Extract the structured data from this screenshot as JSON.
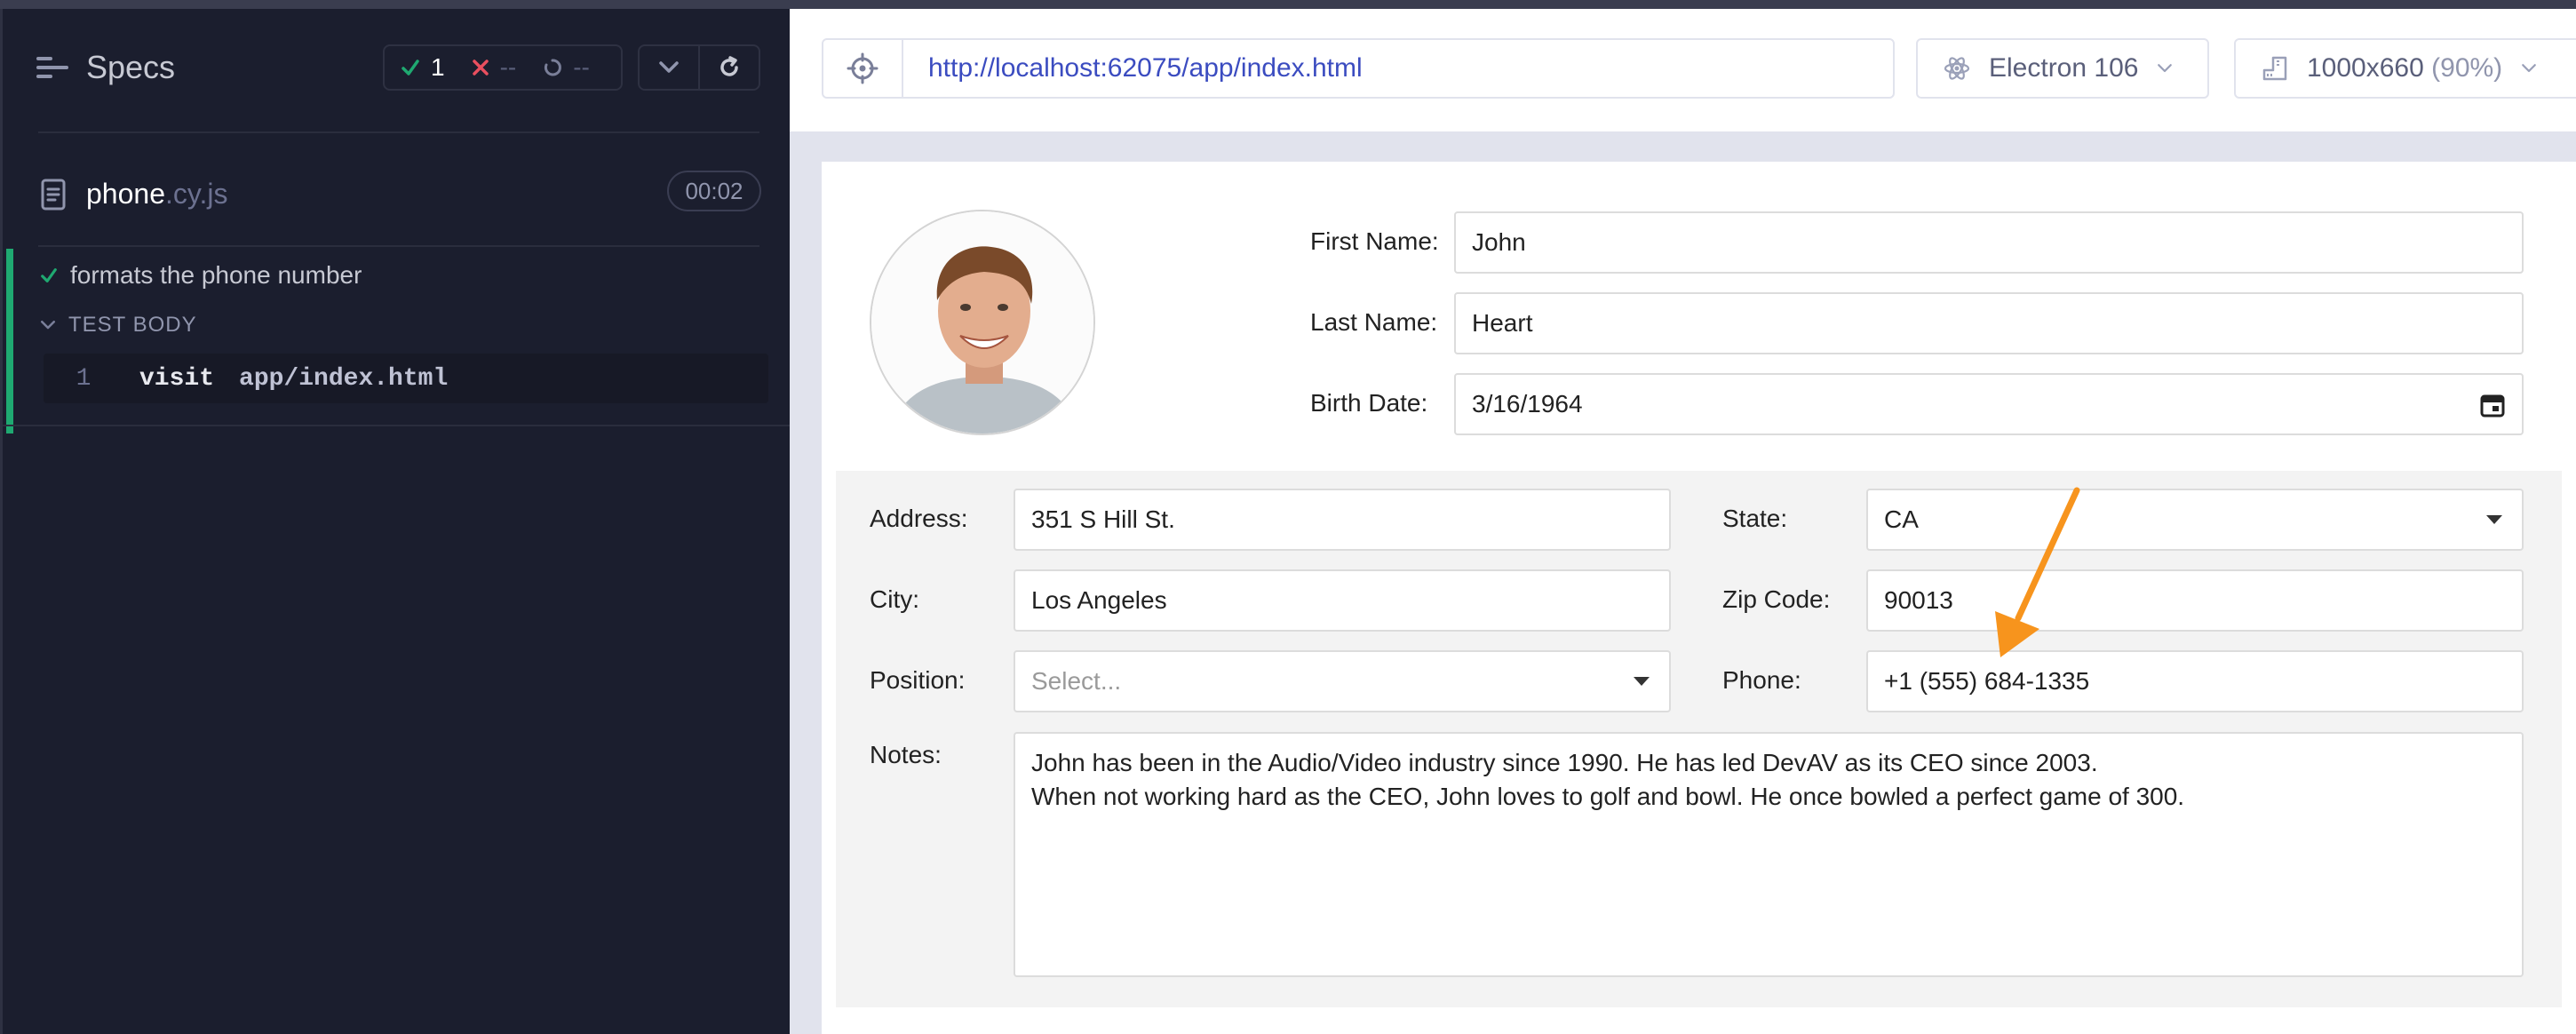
{
  "reporter": {
    "specs_label": "Specs",
    "stats": {
      "passed": "1",
      "failed": "--",
      "pending": "--"
    },
    "spec": {
      "name": "phone",
      "ext": ".cy.js",
      "duration": "00:02"
    },
    "test": {
      "title": "formats the phone number",
      "section": "TEST BODY",
      "command": {
        "number": "1",
        "name": "visit",
        "arg": "app/index.html"
      }
    }
  },
  "aut": {
    "url": "http://localhost:62075/app/index.html",
    "browser": "Electron 106",
    "viewport": {
      "size": "1000x660",
      "scale": "(90%)"
    }
  },
  "form": {
    "first_name": {
      "label": "First Name:",
      "value": "John"
    },
    "last_name": {
      "label": "Last Name:",
      "value": "Heart"
    },
    "birth_date": {
      "label": "Birth Date:",
      "value": "3/16/1964"
    },
    "address": {
      "label": "Address:",
      "value": "351 S Hill St."
    },
    "state": {
      "label": "State:",
      "value": "CA"
    },
    "city": {
      "label": "City:",
      "value": "Los Angeles"
    },
    "zip": {
      "label": "Zip Code:",
      "value": "90013"
    },
    "position": {
      "label": "Position:",
      "placeholder": "Select..."
    },
    "phone": {
      "label": "Phone:",
      "value": "+1 (555) 684-1335"
    },
    "notes": {
      "label": "Notes:",
      "value": "John has been in the Audio/Video industry since 1990. He has led DevAV as its CEO since 2003.\nWhen not working hard as the CEO, John loves to golf and bowl. He once bowled a perfect game of 300."
    }
  },
  "colors": {
    "pass": "#1fa971",
    "fail": "#e94f5f",
    "url": "#3b4cc0",
    "annotation_arrow": "#f7941d"
  },
  "icons": [
    "specs-menu-icon",
    "check-icon",
    "x-icon",
    "pending-spinner-icon",
    "chevron-down-icon",
    "refresh-icon",
    "file-icon",
    "crosshair-icon",
    "electron-icon",
    "ruler-icon",
    "calendar-icon",
    "arrow-annotation"
  ]
}
